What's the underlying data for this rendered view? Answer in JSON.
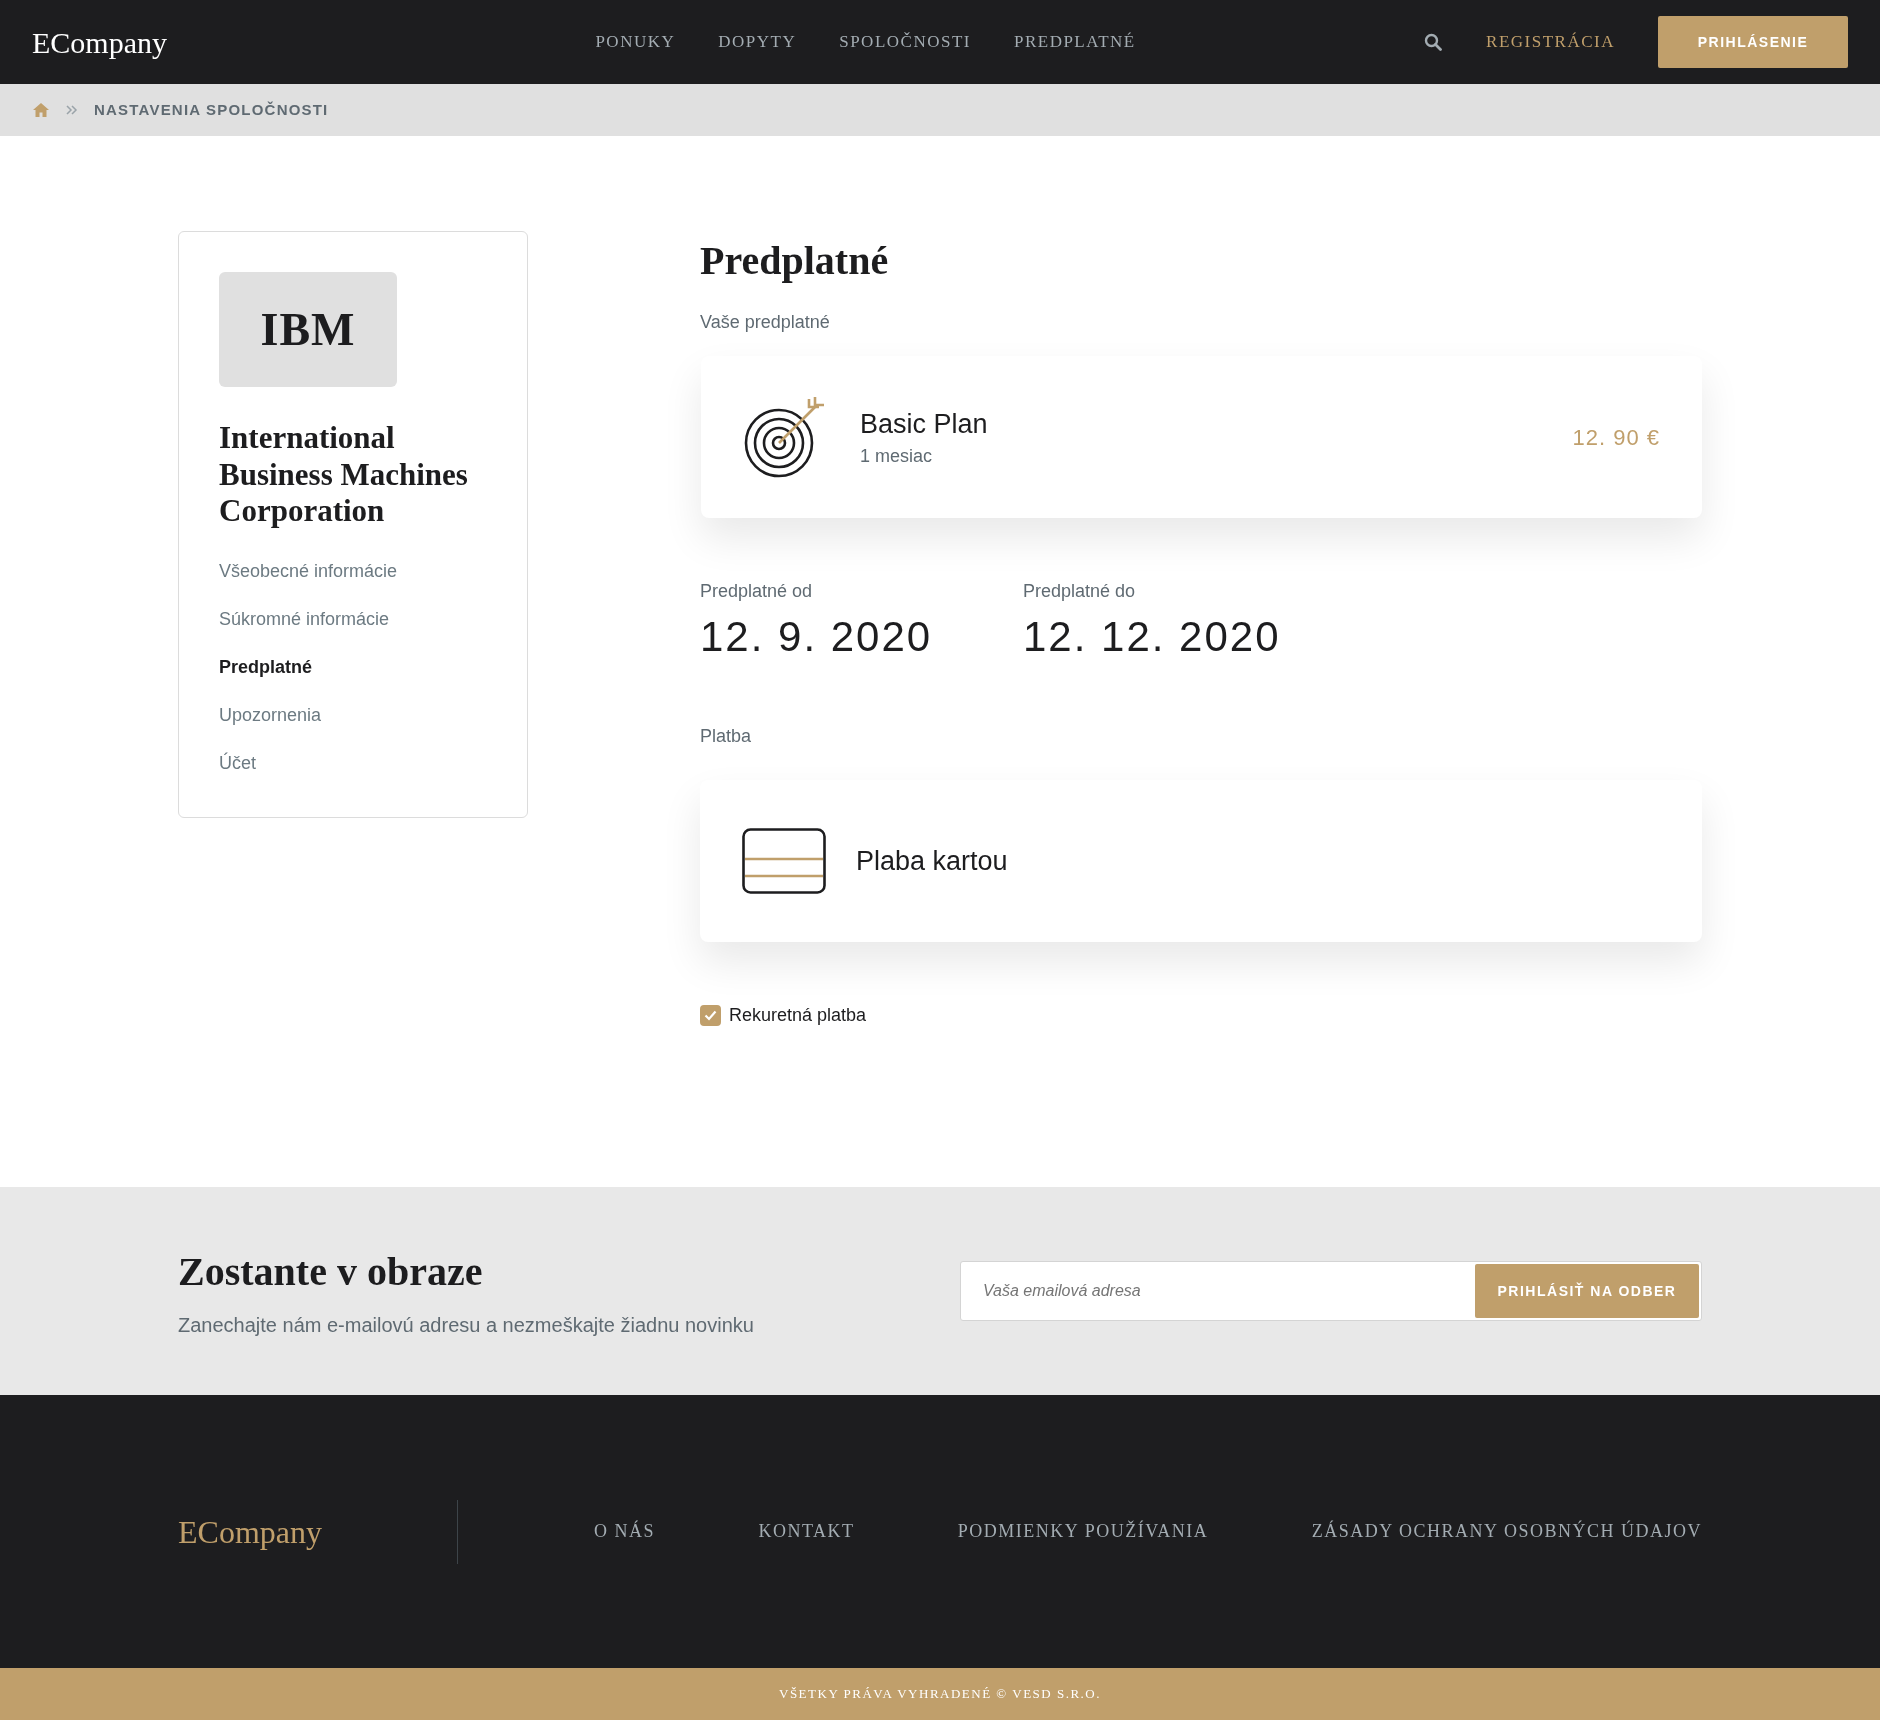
{
  "header": {
    "logo": "ECompany",
    "nav": [
      {
        "label": "PONUKY"
      },
      {
        "label": "DOPYTY"
      },
      {
        "label": "SPOLOČNOSTI"
      },
      {
        "label": "PREDPLATNÉ"
      }
    ],
    "register": "REGISTRÁCIA",
    "login": "PRIHLÁSENIE"
  },
  "breadcrumb": {
    "current": "NASTAVENIA SPOLOČNOSTI"
  },
  "sidebar": {
    "logo_text": "IBM",
    "company": "International Business Machines Corporation",
    "items": [
      {
        "label": "Všeobecné informácie",
        "selected": false
      },
      {
        "label": "Súkromné informácie",
        "selected": false
      },
      {
        "label": "Predplatné",
        "selected": true
      },
      {
        "label": "Upozornenia",
        "selected": false
      },
      {
        "label": "Účet",
        "selected": false
      }
    ]
  },
  "main": {
    "title": "Predplatné",
    "plan_label": "Vaše predplatné",
    "plan": {
      "name": "Basic Plan",
      "period": "1 mesiac",
      "price": "12. 90 €"
    },
    "dates": [
      {
        "label": "Predplatné od",
        "value": "12. 9. 2020"
      },
      {
        "label": "Predplatné do",
        "value": "12. 12. 2020"
      }
    ],
    "payment_label": "Platba",
    "payment": {
      "name": "Plaba kartou"
    },
    "recurring": {
      "label": "Rekuretná platba",
      "checked": true
    }
  },
  "newsletter": {
    "title": "Zostante v obraze",
    "text": "Zanechajte nám e-mailovú adresu a nezmeškajte žiadnu novinku",
    "placeholder": "Vaša emailová adresa",
    "button": "PRIHLÁSIŤ NA ODBER"
  },
  "footer": {
    "logo": "ECompany",
    "links": [
      {
        "label": "O NÁS"
      },
      {
        "label": "KONTAKT"
      },
      {
        "label": "PODMIENKY POUŽÍVANIA"
      },
      {
        "label": "ZÁSADY OCHRANY OSOBNÝCH ÚDAJOV"
      }
    ],
    "copyright": "VŠETKY PRÁVA VYHRADENÉ © VESD S.R.O."
  }
}
